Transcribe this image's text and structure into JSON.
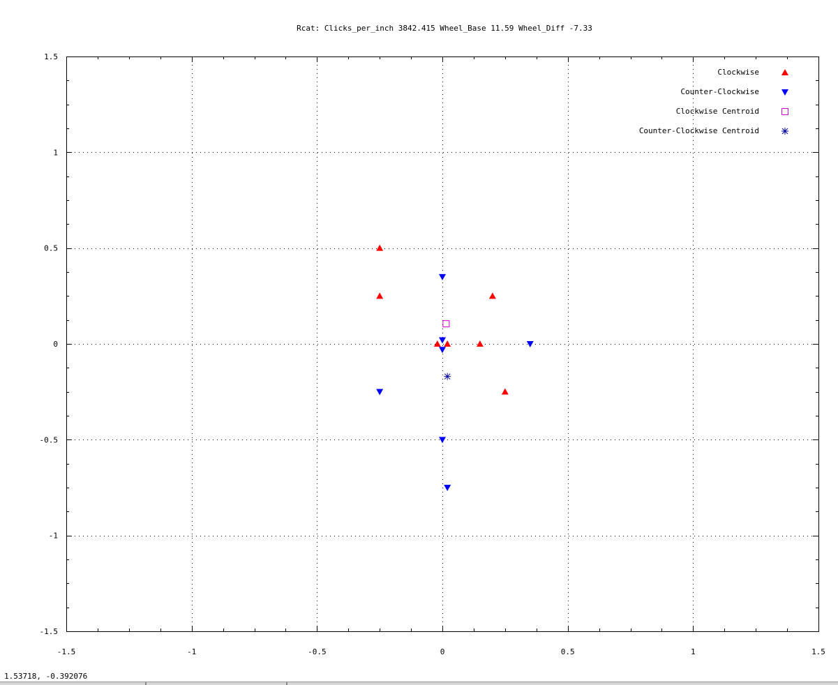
{
  "status": {
    "coordinates": "1.53718, -0.392076"
  },
  "chart_data": {
    "type": "scatter",
    "title": "Rcat: Clicks_per_inch 3842.415   Wheel_Base 11.59   Wheel_Diff -7.33",
    "xlabel": "",
    "ylabel": "",
    "xlim": [
      -1.5,
      1.5
    ],
    "ylim": [
      -1.5,
      1.5
    ],
    "xticks": [
      "-1.5",
      "-1",
      "-0.5",
      "0",
      "0.5",
      "1",
      "1.5"
    ],
    "yticks": [
      "1.5",
      "1",
      "0.5",
      "0",
      "-0.5",
      "-1",
      "-1.5"
    ],
    "grid": true,
    "legend_position": "top-right",
    "series": [
      {
        "name": "Clockwise",
        "marker": "triangle-up",
        "color": "#ff0000",
        "points": [
          [
            -0.25,
            0.5
          ],
          [
            -0.25,
            0.25
          ],
          [
            0.2,
            0.25
          ],
          [
            -0.02,
            0.0
          ],
          [
            0.02,
            0.0
          ],
          [
            0.15,
            0.0
          ],
          [
            0.25,
            -0.25
          ]
        ]
      },
      {
        "name": "Counter-Clockwise",
        "marker": "triangle-down",
        "color": "#0000ff",
        "points": [
          [
            0.0,
            0.35
          ],
          [
            0.0,
            0.02
          ],
          [
            0.0,
            -0.03
          ],
          [
            0.35,
            0.0
          ],
          [
            -0.25,
            -0.25
          ],
          [
            0.0,
            -0.5
          ],
          [
            0.02,
            -0.75
          ]
        ]
      },
      {
        "name": "Clockwise Centroid",
        "marker": "open-square",
        "color": "#cc00cc",
        "points": [
          [
            0.015,
            0.105
          ]
        ]
      },
      {
        "name": "Counter-Clockwise Centroid",
        "marker": "asterisk",
        "color": "#000099",
        "points": [
          [
            0.02,
            -0.17
          ]
        ]
      }
    ]
  }
}
